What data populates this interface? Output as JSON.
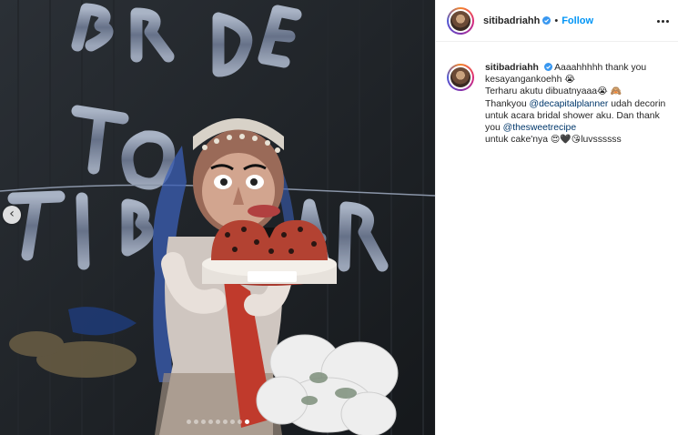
{
  "post": {
    "username": "sitibadriahh",
    "separator": "•",
    "follow_label": "Follow",
    "carousel": {
      "total": 9,
      "active_index": 8
    },
    "prev_arrow": "‹",
    "photo_balloon_text": "BRIDE TO BE"
  },
  "caption": {
    "username": "sitibadriahh",
    "line1": "Aaaahhhhh thank you kesayangankoehh",
    "emoji1": "😭",
    "line2": "Terharu akutu dibuatnyaaa",
    "emoji2": "😭",
    "emoji3": "🙈",
    "line3": "Thankyou",
    "mention1": "@decapitalplanner",
    "line4": "udah decorin untuk acara bridal shower aku. Dan thank you",
    "mention2": "@thesweetrecipe",
    "line5": "untuk cake'nya",
    "emoji4": "😍",
    "emoji5": "🖤",
    "emoji6": "😘",
    "line6": "luvssssss"
  },
  "colors": {
    "link": "#00376b",
    "follow": "#0095f6",
    "verified": "#3897f0"
  },
  "icons": {
    "verified": "verified-badge-icon",
    "more": "more-options-icon",
    "prev": "chevron-left-icon"
  }
}
